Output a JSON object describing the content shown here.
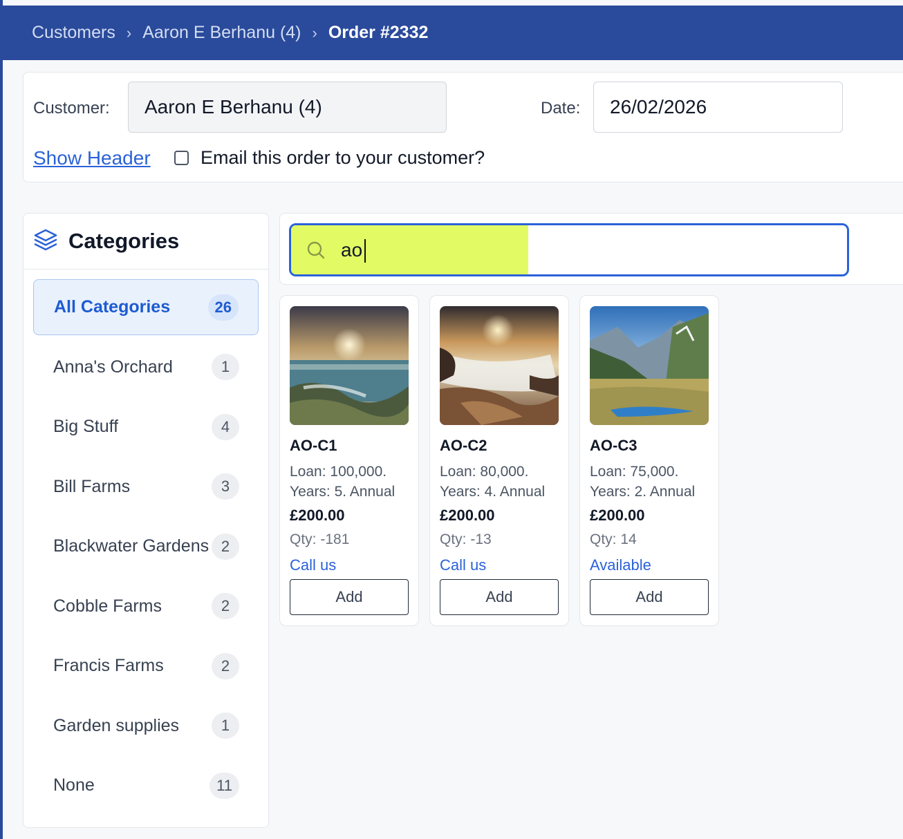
{
  "breadcrumb": {
    "items": [
      "Customers",
      "Aaron E Berhanu (4)"
    ],
    "current": "Order #2332",
    "separator": "›"
  },
  "header": {
    "customer_label": "Customer:",
    "customer_value": "Aaron E Berhanu (4)",
    "date_label": "Date:",
    "date_value": "26/02/2026",
    "show_header_link": "Show Header",
    "email_checkbox_label": "Email this order to your customer?",
    "email_checked": false
  },
  "categories": {
    "title": "Categories",
    "icon": "layers-icon",
    "items": [
      {
        "label": "All Categories",
        "count": "26",
        "active": true
      },
      {
        "label": "Anna's Orchard",
        "count": "1"
      },
      {
        "label": "Big Stuff",
        "count": "4"
      },
      {
        "label": "Bill Farms",
        "count": "3"
      },
      {
        "label": "Blackwater Gardens",
        "count": "2"
      },
      {
        "label": "Cobble Farms",
        "count": "2"
      },
      {
        "label": "Francis Farms",
        "count": "2"
      },
      {
        "label": "Garden supplies",
        "count": "1"
      },
      {
        "label": "None",
        "count": "11"
      }
    ]
  },
  "search": {
    "value": "ao",
    "icon": "search-icon",
    "highlight_color": "#e2fb64",
    "focus_color": "#2a62d8"
  },
  "products": [
    {
      "sku": "AO-C1",
      "desc_line1": "Loan: 100,000.",
      "desc_line2": "Years: 5. Annual",
      "price": "£200.00",
      "qty": "Qty: -181",
      "stock": "Call us",
      "add_label": "Add"
    },
    {
      "sku": "AO-C2",
      "desc_line1": "Loan: 80,000.",
      "desc_line2": "Years: 4. Annual",
      "price": "£200.00",
      "qty": "Qty: -13",
      "stock": "Call us",
      "add_label": "Add"
    },
    {
      "sku": "AO-C3",
      "desc_line1": "Loan: 75,000.",
      "desc_line2": "Years: 2. Annual",
      "price": "£200.00",
      "qty": "Qty: 14",
      "stock": "Available",
      "add_label": "Add"
    }
  ],
  "colors": {
    "brand": "#2a4a9b",
    "accent": "#2a62d8"
  }
}
